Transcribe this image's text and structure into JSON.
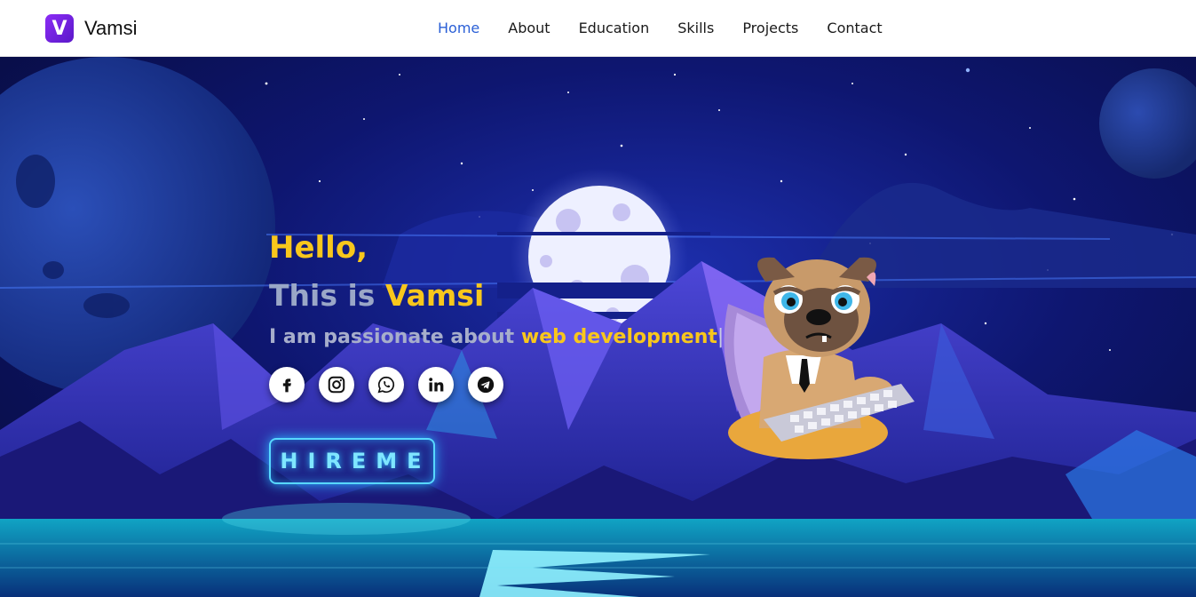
{
  "navbar": {
    "brand": {
      "logo_letter": "V",
      "name": "Vamsi"
    },
    "links": [
      {
        "label": "Home",
        "active": true
      },
      {
        "label": "About",
        "active": false
      },
      {
        "label": "Education",
        "active": false
      },
      {
        "label": "Skills",
        "active": false
      },
      {
        "label": "Projects",
        "active": false
      },
      {
        "label": "Contact",
        "active": false
      }
    ]
  },
  "hero": {
    "greeting": "Hello,",
    "intro_prefix": "This is",
    "intro_name": "Vamsi",
    "tagline_prefix": "I am passionate about",
    "tagline_highlight": "web development",
    "tagline_cursor": "|",
    "socials": [
      {
        "icon": "facebook-icon"
      },
      {
        "icon": "instagram-icon"
      },
      {
        "icon": "whatsapp-icon"
      },
      {
        "icon": "linkedin-icon"
      },
      {
        "icon": "telegram-icon"
      }
    ],
    "hire_button": "HIREME"
  },
  "colors": {
    "accent_yellow": "#f8c71c",
    "nav_active": "#2a5fd6",
    "neon_cyan": "#58d8ff",
    "brand_purple": "#8b2cf5"
  }
}
